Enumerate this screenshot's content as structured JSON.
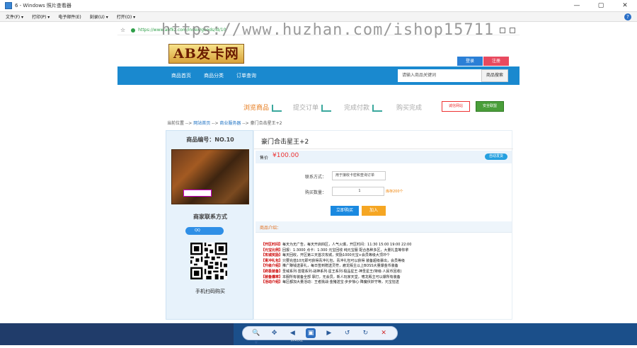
{
  "window": {
    "title": "6 - Windows 照片查看器",
    "controls": [
      "—",
      "▢",
      "✕"
    ]
  },
  "menu": {
    "items": [
      "文件(F) ▾",
      "打印(P) ▾",
      "电子邮件(E)",
      "刻录(U) ▾",
      "打开(O) ▾"
    ],
    "help": "?"
  },
  "browser": {
    "url": "https://www.abfkz.com/index/goods/id/10"
  },
  "watermark": "https://www.huzhan.com/ishop15711",
  "site": {
    "logo": "AB发卡网",
    "login": "登录",
    "register": "注册",
    "nav": [
      "商品首页",
      "商品分类",
      "订单查询"
    ],
    "search_placeholder": "请输入商品关键词",
    "search_button": "商品搜索",
    "steps": [
      "浏览商品",
      "提交订单",
      "完成付款",
      "购买完成"
    ],
    "badge1": "诚信网站",
    "badge2": "安全联盟",
    "breadcrumb": {
      "prefix": "当前位置 -->",
      "home": "网站首页",
      "sep": "-->",
      "cat": "商业服务器",
      "item": "豪门合击星王+2"
    }
  },
  "product": {
    "number": "商品编号：NO.10",
    "contact_title": "商家联系方式",
    "qq": "QQ",
    "qr_label": "手机扫码购买",
    "title": "豪门合击星王+2",
    "price_label": "售价",
    "price": "¥100.00",
    "auto_tag": "自动发货",
    "contact_label": "联系方式：",
    "contact_placeholder": "用于接收卡密和查询订单",
    "qty_label": "购买数量：",
    "qty": "1",
    "stock": "库存200个",
    "buy": "立即购买",
    "cart": "加入",
    "intro_title": "商品介绍：",
    "intro_lines": [
      {
        "tag": "【开区时间】",
        "text": "每天为无广告，每天开启四区，人气火爆，开区时间：11:30  15:00  19:00  22:00"
      },
      {
        "tag": "【元宝比例】",
        "text": "回报：1:3000  点卡：1:300  元宝回收  纯元宝服  配合各种多区，大量礼盒等你拿"
      },
      {
        "tag": "【攻城奖励】",
        "text": "每天回收，开区第三天首次攻城，奖励1000元宝+会员等级大顶冲个"
      },
      {
        "tag": "【青冲礼包】",
        "text": "只要充值10元即可获得青冲礼包，青冲礼包可以获得 装备超级暴出，会员等级"
      },
      {
        "tag": "【升级介绍】",
        "text": "推广赚钱送豪礼，每日签到赠送灵符，雇龙殿主以上BOSS大量爆金币装备"
      },
      {
        "tag": "【终极装备】",
        "text": "圣域系列·雷霆系列·战神系列·星王系列·极品星王·神圣星王(特级·人民币回收)"
      },
      {
        "tag": "【装备爆率】",
        "text": "本服所有装备全部  靠打，无会员，新人玩家天堂，嗜龙殿主可以爆所有装备"
      },
      {
        "tag": "【活动介绍】",
        "text": "每区都加大量活动：王者挑战·金猪送宝·步步惊心·降魔伏妖守等，元宝狂送"
      }
    ]
  },
  "desktop": {
    "bottom_text": "会跳过"
  },
  "toolbar": {
    "zoom": "🔍▾",
    "fit": "✥",
    "prev": "◀",
    "play": "▣",
    "next": "▶",
    "rotl": "↺",
    "rotr": "↻",
    "del": "✕"
  }
}
